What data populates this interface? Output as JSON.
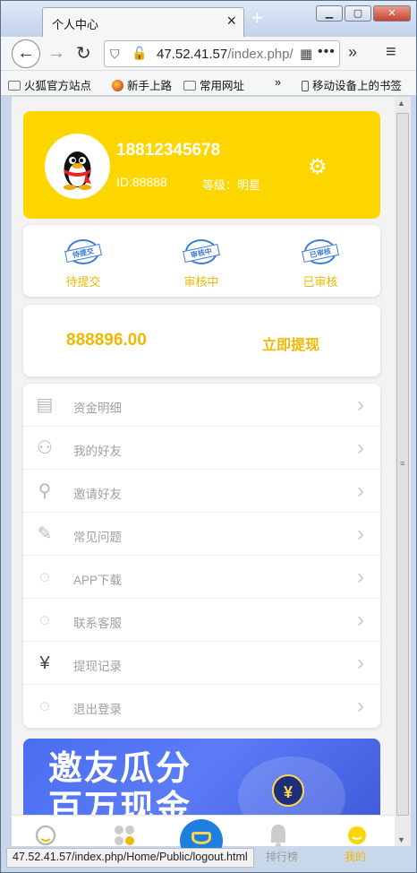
{
  "browser": {
    "tab_title": "个人中心",
    "tab_close": "×",
    "new_tab": "+",
    "url_host": "47.52.41.57",
    "url_path": "/index.php/",
    "url_more": "•••",
    "overflow": "»",
    "menu": "≡",
    "bookmarks": [
      "火狐官方站点",
      "新手上路",
      "常用网址",
      "移动设备上的书签"
    ],
    "status_url": "47.52.41.57/index.php/Home/Public/logout.html"
  },
  "profile": {
    "phone": "18812345678",
    "id_text": "ID:88888",
    "level_text": "等级：明星"
  },
  "status_items": [
    {
      "stamp": "待提交",
      "label": "待提交"
    },
    {
      "stamp": "审核中",
      "label": "审核中"
    },
    {
      "stamp": "已审核",
      "label": "已审核"
    }
  ],
  "balance": {
    "amount": "888896.00",
    "withdraw_label": "立即提现"
  },
  "menu": [
    {
      "label": "资金明细",
      "icon": "ledger-icon"
    },
    {
      "label": "我的好友",
      "icon": "friends-icon"
    },
    {
      "label": "邀请好友",
      "icon": "add-user-icon"
    },
    {
      "label": "常见问题",
      "icon": "faq-icon"
    },
    {
      "label": "APP下载",
      "icon": "chat-bubble-icon"
    },
    {
      "label": "联系客服",
      "icon": "chat-bubble-icon"
    },
    {
      "label": "提现记录",
      "icon": "yuan-box-icon"
    },
    {
      "label": "退出登录",
      "icon": "chat-bubble-icon"
    }
  ],
  "banner": {
    "line1": "邀友瓜分",
    "line2": "百万现金"
  },
  "tabbar": {
    "rank_label": "排行榜",
    "mine_label": "我的"
  },
  "colors": {
    "accent": "#fdd600",
    "accent_text": "#f0b800",
    "stamp_blue": "#3a7bd5",
    "center_button": "#1f7fe0"
  }
}
